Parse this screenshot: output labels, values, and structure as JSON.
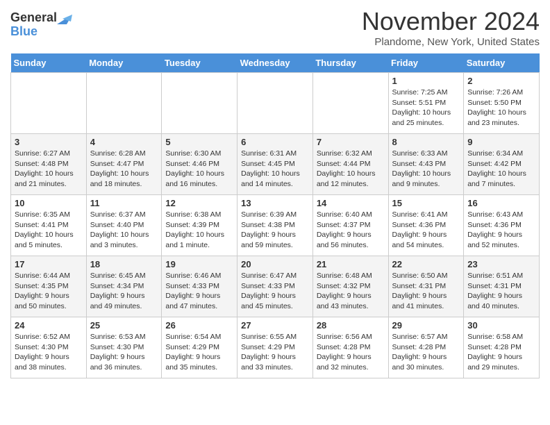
{
  "header": {
    "logo_line1": "General",
    "logo_line2": "Blue",
    "month": "November 2024",
    "location": "Plandome, New York, United States"
  },
  "weekdays": [
    "Sunday",
    "Monday",
    "Tuesday",
    "Wednesday",
    "Thursday",
    "Friday",
    "Saturday"
  ],
  "weeks": [
    [
      {
        "day": "",
        "info": ""
      },
      {
        "day": "",
        "info": ""
      },
      {
        "day": "",
        "info": ""
      },
      {
        "day": "",
        "info": ""
      },
      {
        "day": "",
        "info": ""
      },
      {
        "day": "1",
        "info": "Sunrise: 7:25 AM\nSunset: 5:51 PM\nDaylight: 10 hours and 25 minutes."
      },
      {
        "day": "2",
        "info": "Sunrise: 7:26 AM\nSunset: 5:50 PM\nDaylight: 10 hours and 23 minutes."
      }
    ],
    [
      {
        "day": "3",
        "info": "Sunrise: 6:27 AM\nSunset: 4:48 PM\nDaylight: 10 hours and 21 minutes."
      },
      {
        "day": "4",
        "info": "Sunrise: 6:28 AM\nSunset: 4:47 PM\nDaylight: 10 hours and 18 minutes."
      },
      {
        "day": "5",
        "info": "Sunrise: 6:30 AM\nSunset: 4:46 PM\nDaylight: 10 hours and 16 minutes."
      },
      {
        "day": "6",
        "info": "Sunrise: 6:31 AM\nSunset: 4:45 PM\nDaylight: 10 hours and 14 minutes."
      },
      {
        "day": "7",
        "info": "Sunrise: 6:32 AM\nSunset: 4:44 PM\nDaylight: 10 hours and 12 minutes."
      },
      {
        "day": "8",
        "info": "Sunrise: 6:33 AM\nSunset: 4:43 PM\nDaylight: 10 hours and 9 minutes."
      },
      {
        "day": "9",
        "info": "Sunrise: 6:34 AM\nSunset: 4:42 PM\nDaylight: 10 hours and 7 minutes."
      }
    ],
    [
      {
        "day": "10",
        "info": "Sunrise: 6:35 AM\nSunset: 4:41 PM\nDaylight: 10 hours and 5 minutes."
      },
      {
        "day": "11",
        "info": "Sunrise: 6:37 AM\nSunset: 4:40 PM\nDaylight: 10 hours and 3 minutes."
      },
      {
        "day": "12",
        "info": "Sunrise: 6:38 AM\nSunset: 4:39 PM\nDaylight: 10 hours and 1 minute."
      },
      {
        "day": "13",
        "info": "Sunrise: 6:39 AM\nSunset: 4:38 PM\nDaylight: 9 hours and 59 minutes."
      },
      {
        "day": "14",
        "info": "Sunrise: 6:40 AM\nSunset: 4:37 PM\nDaylight: 9 hours and 56 minutes."
      },
      {
        "day": "15",
        "info": "Sunrise: 6:41 AM\nSunset: 4:36 PM\nDaylight: 9 hours and 54 minutes."
      },
      {
        "day": "16",
        "info": "Sunrise: 6:43 AM\nSunset: 4:36 PM\nDaylight: 9 hours and 52 minutes."
      }
    ],
    [
      {
        "day": "17",
        "info": "Sunrise: 6:44 AM\nSunset: 4:35 PM\nDaylight: 9 hours and 50 minutes."
      },
      {
        "day": "18",
        "info": "Sunrise: 6:45 AM\nSunset: 4:34 PM\nDaylight: 9 hours and 49 minutes."
      },
      {
        "day": "19",
        "info": "Sunrise: 6:46 AM\nSunset: 4:33 PM\nDaylight: 9 hours and 47 minutes."
      },
      {
        "day": "20",
        "info": "Sunrise: 6:47 AM\nSunset: 4:33 PM\nDaylight: 9 hours and 45 minutes."
      },
      {
        "day": "21",
        "info": "Sunrise: 6:48 AM\nSunset: 4:32 PM\nDaylight: 9 hours and 43 minutes."
      },
      {
        "day": "22",
        "info": "Sunrise: 6:50 AM\nSunset: 4:31 PM\nDaylight: 9 hours and 41 minutes."
      },
      {
        "day": "23",
        "info": "Sunrise: 6:51 AM\nSunset: 4:31 PM\nDaylight: 9 hours and 40 minutes."
      }
    ],
    [
      {
        "day": "24",
        "info": "Sunrise: 6:52 AM\nSunset: 4:30 PM\nDaylight: 9 hours and 38 minutes."
      },
      {
        "day": "25",
        "info": "Sunrise: 6:53 AM\nSunset: 4:30 PM\nDaylight: 9 hours and 36 minutes."
      },
      {
        "day": "26",
        "info": "Sunrise: 6:54 AM\nSunset: 4:29 PM\nDaylight: 9 hours and 35 minutes."
      },
      {
        "day": "27",
        "info": "Sunrise: 6:55 AM\nSunset: 4:29 PM\nDaylight: 9 hours and 33 minutes."
      },
      {
        "day": "28",
        "info": "Sunrise: 6:56 AM\nSunset: 4:28 PM\nDaylight: 9 hours and 32 minutes."
      },
      {
        "day": "29",
        "info": "Sunrise: 6:57 AM\nSunset: 4:28 PM\nDaylight: 9 hours and 30 minutes."
      },
      {
        "day": "30",
        "info": "Sunrise: 6:58 AM\nSunset: 4:28 PM\nDaylight: 9 hours and 29 minutes."
      }
    ]
  ]
}
